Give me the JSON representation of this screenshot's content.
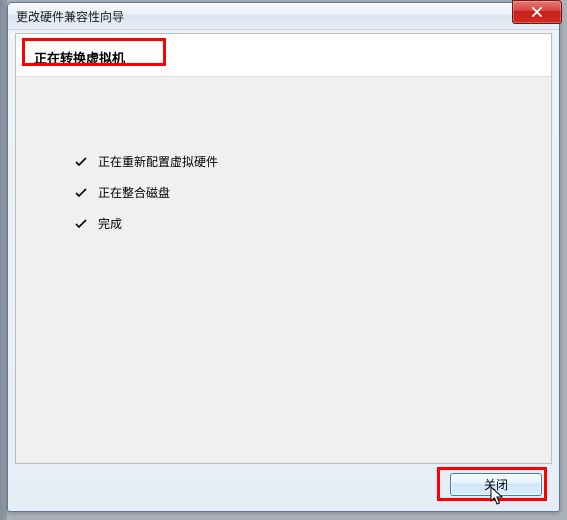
{
  "window": {
    "title": "更改硬件兼容性向导"
  },
  "panel": {
    "heading": "正在转换虚拟机"
  },
  "steps": [
    {
      "label": "正在重新配置虚拟硬件"
    },
    {
      "label": "正在整合磁盘"
    },
    {
      "label": "完成"
    }
  ],
  "footer": {
    "close_label": "关闭"
  },
  "icons": {
    "close": "close-icon",
    "check": "check-icon"
  },
  "colors": {
    "highlight": "#ff0000",
    "close_btn": "#c8201a",
    "button_border": "#3c7fb1"
  }
}
